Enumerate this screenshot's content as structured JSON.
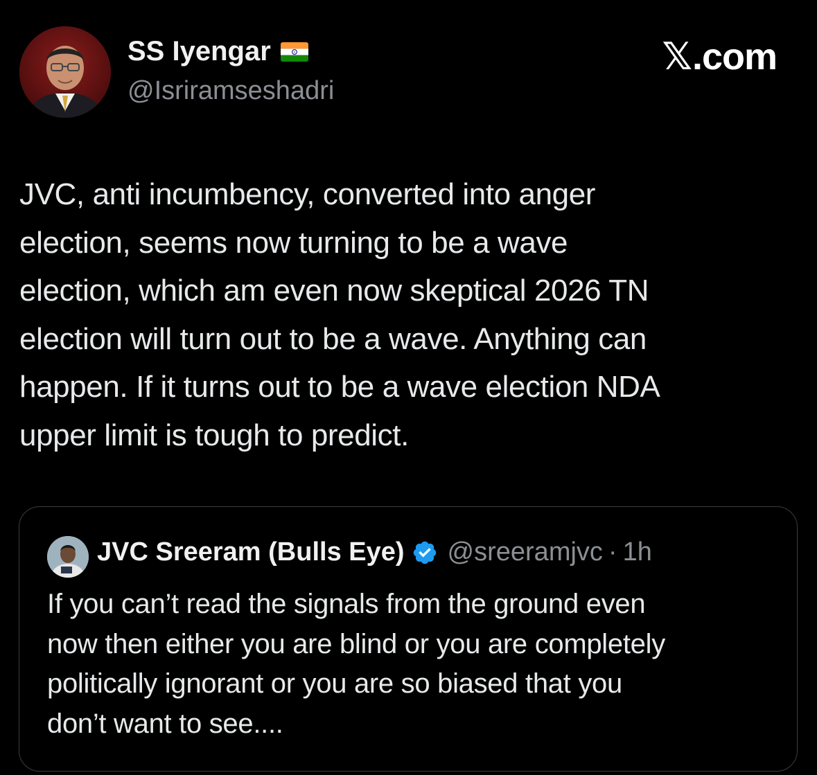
{
  "author": {
    "display_name": "SS Iyengar",
    "handle": "@Isriramseshadri",
    "flag_icon": "india-flag-icon"
  },
  "brand": {
    "x_glyph": "𝕏",
    "domain": ".com"
  },
  "tweet": {
    "text": "JVC, anti incumbency, converted into anger\nelection, seems now turning to be a wave\nelection, which am even now skeptical 2026 TN\nelection will turn out to be a wave. Anything can\nhappen. If it turns out to be a wave election NDA\nupper limit is tough to predict."
  },
  "quoted_tweet": {
    "display_name": "JVC Sreeram (Bulls Eye)",
    "verified_icon": "verified-badge-icon",
    "handle": "@sreeramjvc",
    "separator": "·",
    "time": "1h",
    "text": "If you can’t read the signals from the ground even\nnow then either you are blind or you are completely\npolitically ignorant or you are so biased that you\ndon’t want to see...."
  },
  "colors": {
    "background": "#000000",
    "text_primary": "#e7e9ea",
    "text_secondary": "#8b8f94",
    "card_border": "#3a3d40",
    "verified_blue": "#1d9bf0",
    "avatar_bg": "#6e1414"
  }
}
